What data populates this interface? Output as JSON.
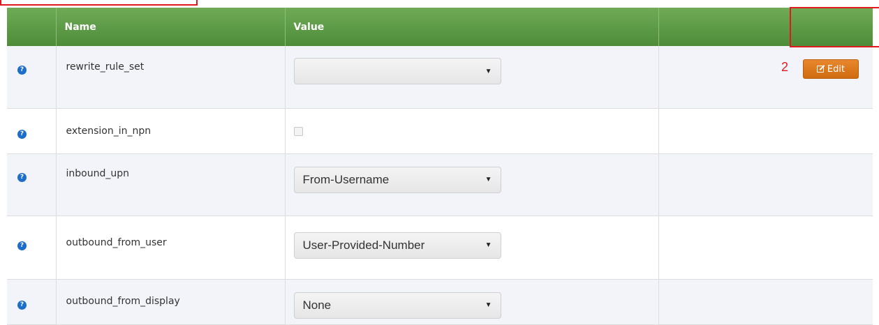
{
  "table": {
    "columns": [
      "",
      "Name",
      "Value",
      ""
    ],
    "rows": [
      {
        "name": "rewrite_rule_set",
        "control": "select",
        "value": ""
      },
      {
        "name": "extension_in_npn",
        "control": "checkbox",
        "checked": false
      },
      {
        "name": "inbound_upn",
        "control": "select",
        "value": "From-Username"
      },
      {
        "name": "outbound_from_user",
        "control": "select",
        "value": "User-Provided-Number"
      },
      {
        "name": "outbound_from_display",
        "control": "select",
        "value": "None"
      }
    ]
  },
  "help_icon": "?",
  "caret": "▼",
  "edit_button": {
    "label": "Edit",
    "icon": "edit-icon",
    "color": "#d9761c"
  },
  "annotation": {
    "step": "2",
    "color": "#e0191f"
  },
  "header_color": "#5f9c47"
}
